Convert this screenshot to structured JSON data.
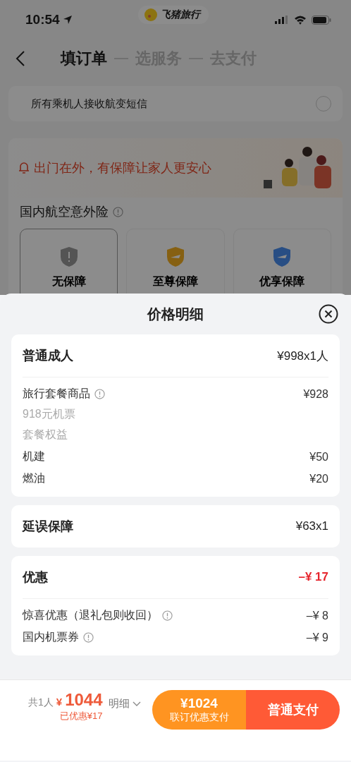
{
  "status_bar": {
    "time": "10:54",
    "app_badge": "飞猪旅行"
  },
  "nav": {
    "steps": [
      {
        "label": "填订单",
        "selected": true
      },
      {
        "label": "选服务",
        "selected": false
      },
      {
        "label": "去支付",
        "selected": false
      }
    ]
  },
  "sms_option": {
    "label": "所有乘机人接收航变短信",
    "checked": false
  },
  "banner": {
    "text": "出门在外，有保障让家人更安心"
  },
  "insurance": {
    "title": "国内航空意外险",
    "options": [
      {
        "label": "无保障",
        "kind": "none",
        "selected": true
      },
      {
        "label": "至尊保障",
        "kind": "gold",
        "selected": false
      },
      {
        "label": "优享保障",
        "kind": "blue",
        "selected": false
      }
    ]
  },
  "sheet": {
    "title": "价格明细",
    "sections": [
      {
        "title": "普通成人",
        "amount": "¥998x1人",
        "highlight": false,
        "items": [
          {
            "label": "旅行套餐商品",
            "info": true,
            "amount": "¥928",
            "notes": [
              "918元机票",
              "套餐权益"
            ]
          },
          {
            "label": "机建",
            "info": false,
            "amount": "¥50"
          },
          {
            "label": "燃油",
            "info": false,
            "amount": "¥20"
          }
        ]
      },
      {
        "title": "延误保障",
        "amount": "¥63x1",
        "highlight": false
      },
      {
        "title": "优惠",
        "amount": "–¥ 17",
        "highlight": true,
        "items": [
          {
            "label": "惊喜优惠（退礼包则收回）",
            "info": true,
            "amount": "–¥ 8"
          },
          {
            "label": "国内机票券",
            "info": true,
            "amount": "–¥ 9"
          }
        ]
      }
    ]
  },
  "footer": {
    "people": "共1人",
    "currency": "¥",
    "total": "1044",
    "saved": "已优惠¥17",
    "details": "明细",
    "combo_price": "¥1024",
    "combo_label": "联订优惠支付",
    "pay_label": "普通支付"
  }
}
